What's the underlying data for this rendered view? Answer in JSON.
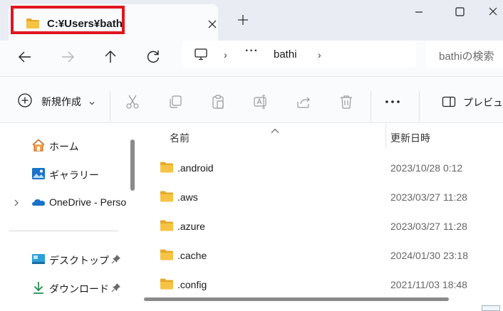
{
  "tab": {
    "title": "C:¥Users¥bathi",
    "close_label": "✕",
    "new_tab_label": "+"
  },
  "window": {
    "minimize": "—",
    "maximize": "☐",
    "close": "✕"
  },
  "address": {
    "more": "···",
    "crumb": "bathi",
    "sep": "›"
  },
  "search": {
    "placeholder": "bathiの検索"
  },
  "commands": {
    "new_label": "新規作成",
    "preview_label": "プレビュー"
  },
  "nav": {
    "items": [
      {
        "label": "ホーム",
        "icon": "home-icon"
      },
      {
        "label": "ギャラリー",
        "icon": "gallery-icon"
      },
      {
        "label": "OneDrive - Personal",
        "icon": "onedrive-cloud-icon"
      },
      {
        "label": "デスクトップ",
        "icon": "desktop-icon",
        "pinned": true
      },
      {
        "label": "ダウンロード",
        "icon": "download-icon",
        "pinned": true
      }
    ]
  },
  "list": {
    "columns": {
      "name": "名前",
      "modified": "更新日時"
    },
    "rows": [
      {
        "name": ".android",
        "modified": "2023/10/28 0:12"
      },
      {
        "name": ".aws",
        "modified": "2023/03/27 11:28"
      },
      {
        "name": ".azure",
        "modified": "2023/03/27 11:28"
      },
      {
        "name": ".cache",
        "modified": "2024/01/30 23:18"
      },
      {
        "name": ".config",
        "modified": "2021/11/03 18:48"
      }
    ]
  },
  "colors": {
    "highlight": "#e0161f",
    "folder": "#f6c344",
    "accent": "#0067c0"
  }
}
